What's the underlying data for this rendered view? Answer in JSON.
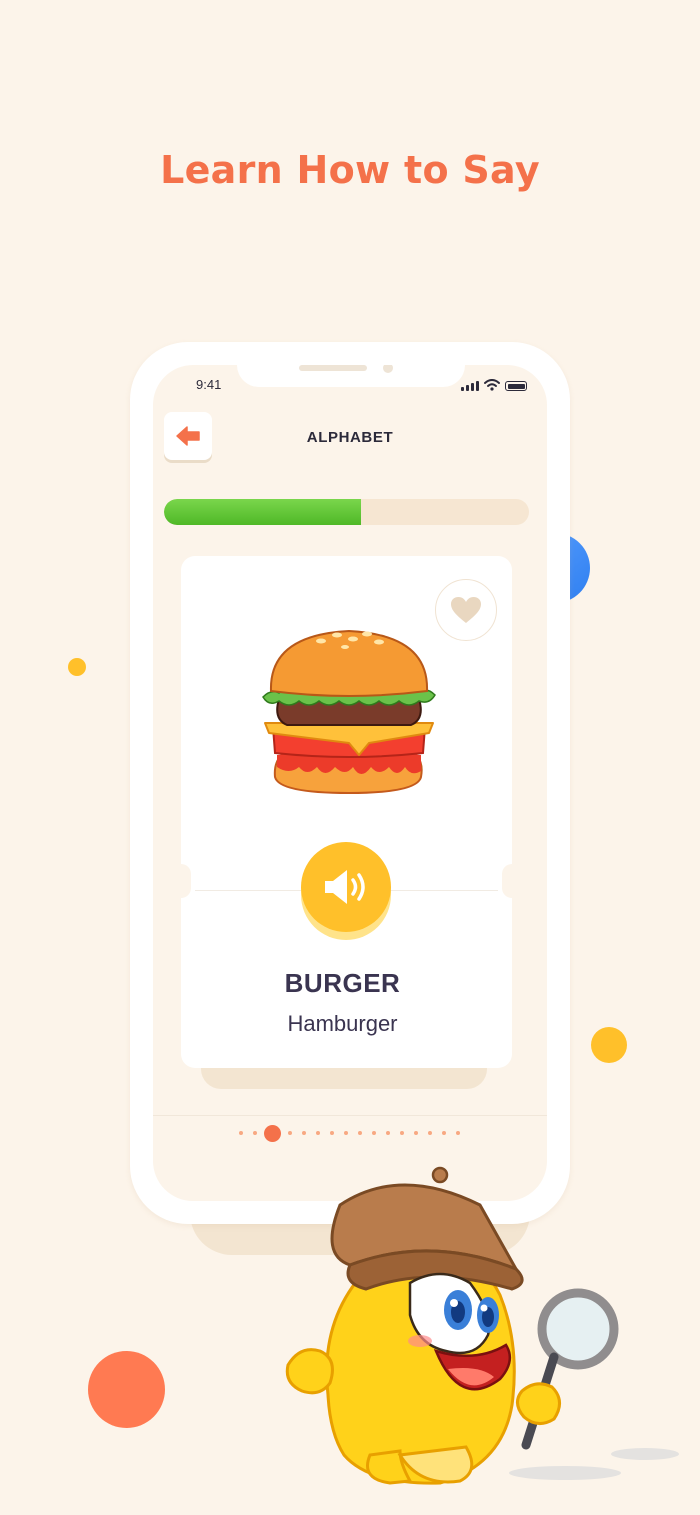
{
  "headline": "Learn How to Say",
  "status_bar": {
    "time": "9:41"
  },
  "screen": {
    "title": "ALPHABET",
    "progress": 0.54,
    "card": {
      "word": "BURGER",
      "translation": "Hamburger",
      "image": "burger-illustration"
    },
    "pager": {
      "total": 16,
      "active_index": 2
    }
  },
  "colors": {
    "background": "#fcf4ea",
    "accent": "#f4714a",
    "progress": "#5cc832",
    "sound_button": "#ffc02a",
    "title_text": "#2c2a3a"
  },
  "icons": [
    "back-arrow-icon",
    "heart-icon",
    "speaker-icon",
    "signal-icon",
    "wifi-icon",
    "battery-icon"
  ]
}
